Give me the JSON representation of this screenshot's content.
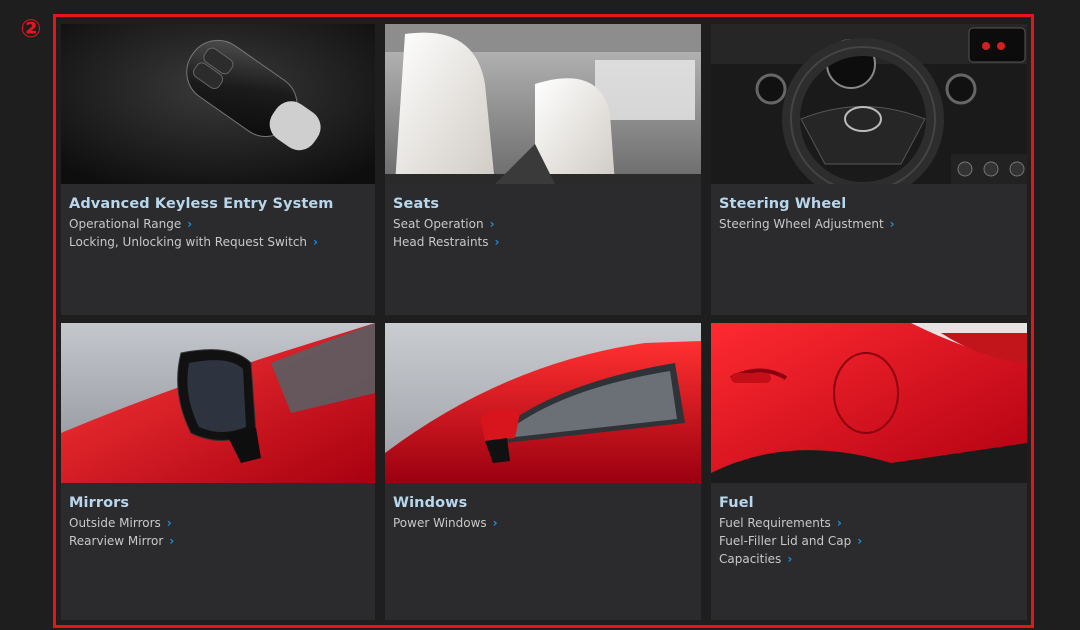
{
  "marker": "②",
  "cards": [
    {
      "title": "Advanced Keyless Entry System",
      "image_icon": "key-fob-photo",
      "links": [
        "Operational Range",
        "Locking, Unlocking with Request Switch"
      ]
    },
    {
      "title": "Seats",
      "image_icon": "seats-photo",
      "links": [
        "Seat Operation",
        "Head Restraints"
      ]
    },
    {
      "title": "Steering Wheel",
      "image_icon": "steering-wheel-photo",
      "links": [
        "Steering Wheel Adjustment"
      ]
    },
    {
      "title": "Mirrors",
      "image_icon": "mirror-photo",
      "links": [
        "Outside Mirrors",
        "Rearview Mirror"
      ]
    },
    {
      "title": "Windows",
      "image_icon": "window-photo",
      "links": [
        "Power Windows"
      ]
    },
    {
      "title": "Fuel",
      "image_icon": "fuel-lid-photo",
      "links": [
        "Fuel Requirements",
        "Fuel-Filler Lid and Cap",
        "Capacities"
      ]
    }
  ],
  "chevron_glyph": "›",
  "colors": {
    "accent_red": "#e4151b",
    "title_blue": "#b9d7ec",
    "chevron_blue": "#1a8fe0",
    "card_bg": "#2b2b2d",
    "page_bg": "#1e1e1e"
  }
}
